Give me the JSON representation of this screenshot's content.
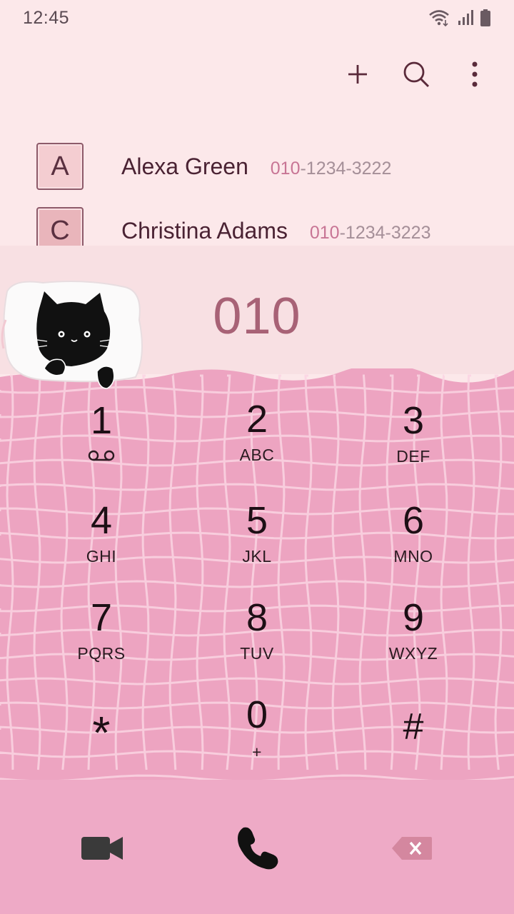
{
  "status": {
    "time": "12:45"
  },
  "toolbar": {
    "add_icon": "plus-icon",
    "search_icon": "search-icon",
    "more_icon": "more-vertical-icon"
  },
  "contacts": [
    {
      "initial": "A",
      "name": "Alexa Green",
      "number_match": "010",
      "number_rest": "-1234-3222"
    },
    {
      "initial": "C",
      "name": "Christina Adams",
      "number_match": "010",
      "number_rest": "-1234-3223"
    }
  ],
  "dialer": {
    "number": "010"
  },
  "keypad": [
    {
      "digit": "1",
      "letters": ""
    },
    {
      "digit": "2",
      "letters": "ABC"
    },
    {
      "digit": "3",
      "letters": "DEF"
    },
    {
      "digit": "4",
      "letters": "GHI"
    },
    {
      "digit": "5",
      "letters": "JKL"
    },
    {
      "digit": "6",
      "letters": "MNO"
    },
    {
      "digit": "7",
      "letters": "PQRS"
    },
    {
      "digit": "8",
      "letters": "TUV"
    },
    {
      "digit": "9",
      "letters": "WXYZ"
    },
    {
      "digit": "*",
      "letters": ""
    },
    {
      "digit": "0",
      "letters": "+"
    },
    {
      "digit": "#",
      "letters": ""
    }
  ],
  "bottom": {
    "video_icon": "video-call-icon",
    "call_icon": "phone-call-icon",
    "backspace_icon": "backspace-icon"
  },
  "colors": {
    "background": "#fce8ea",
    "blanket": "#eda4c1",
    "grid": "#fbd5e3",
    "accent": "#a86276",
    "bottom_bar": "#eeaac6"
  }
}
